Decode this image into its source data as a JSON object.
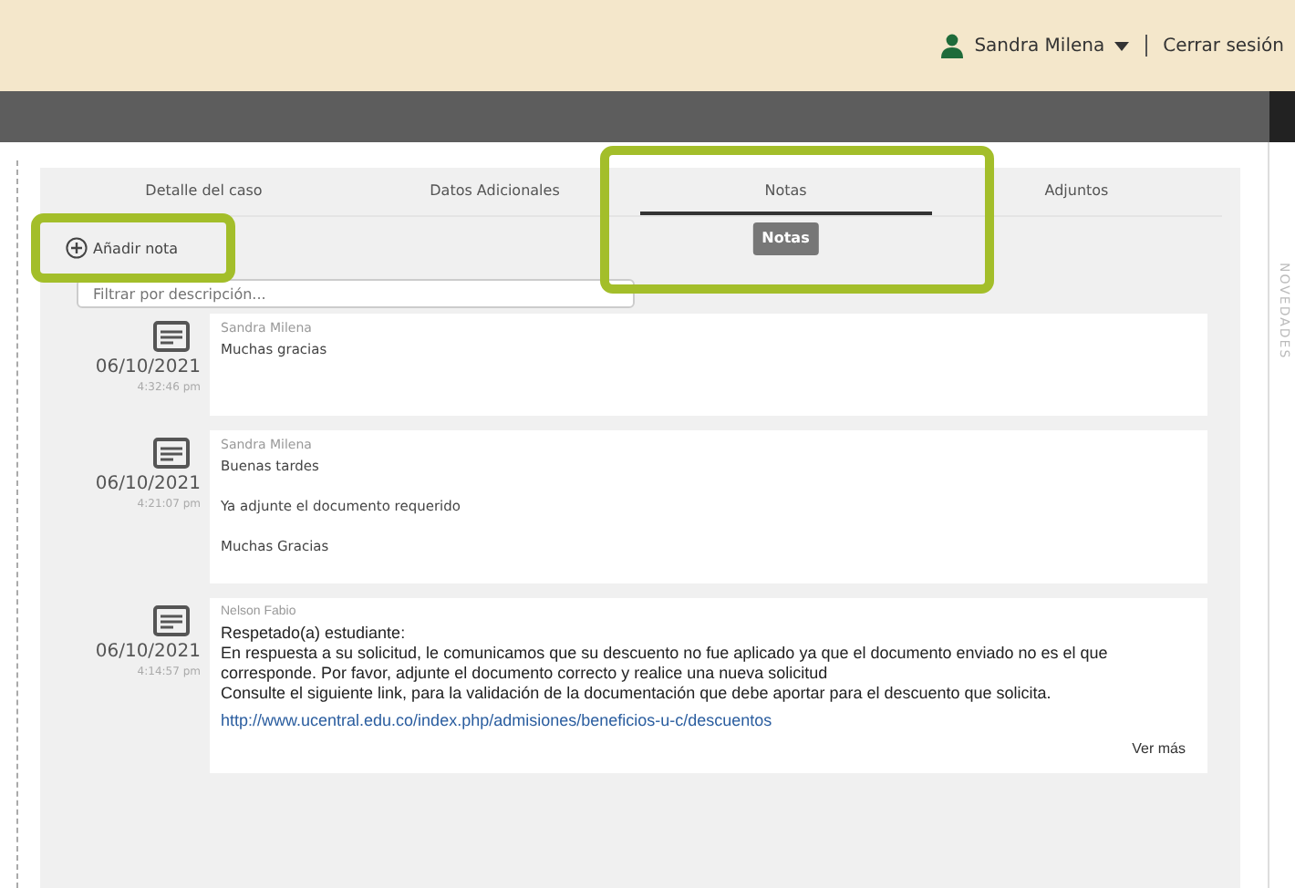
{
  "header": {
    "user": "Sandra Milena",
    "logout": "Cerrar sesión"
  },
  "tabs": [
    {
      "label": "Detalle del caso",
      "selected": false
    },
    {
      "label": "Datos Adicionales",
      "selected": false
    },
    {
      "label": "Notas",
      "selected": true
    },
    {
      "label": "Adjuntos",
      "selected": false
    }
  ],
  "tooltip": "Notas",
  "add_note": "Añadir nota",
  "filter": {
    "placeholder": "Filtrar por descripción..."
  },
  "notes": [
    {
      "kind": "plain",
      "author": "Sandra Milena",
      "date": "06/10/2021",
      "time": "4:32:46 pm",
      "paragraphs": [
        "Muchas gracias"
      ]
    },
    {
      "kind": "plain",
      "author": "Sandra Milena",
      "date": "06/10/2021",
      "time": "4:21:07 pm",
      "paragraphs": [
        "Buenas tardes",
        "Ya adjunte el documento requerido",
        "Muchas Gracias"
      ]
    },
    {
      "kind": "formatted",
      "author": "Nelson Fabio",
      "date": "06/10/2021",
      "time": "4:14:57 pm",
      "paragraphs": [
        "Respetado(a) estudiante:",
        "En respuesta a su solicitud, le comunicamos que su descuento no fue aplicado ya que el documento enviado no es el que corresponde. Por favor, adjunte el documento correcto y realice una nueva solicitud",
        "Consulte el siguiente link, para la validación de la documentación que debe aportar para el descuento que solicita."
      ],
      "link": "http://www.ucentral.edu.co/index.php/admisiones/beneficios-u-c/descuentos",
      "more": "Ver más"
    }
  ],
  "side_panel": {
    "label": "NOVEDADES"
  }
}
